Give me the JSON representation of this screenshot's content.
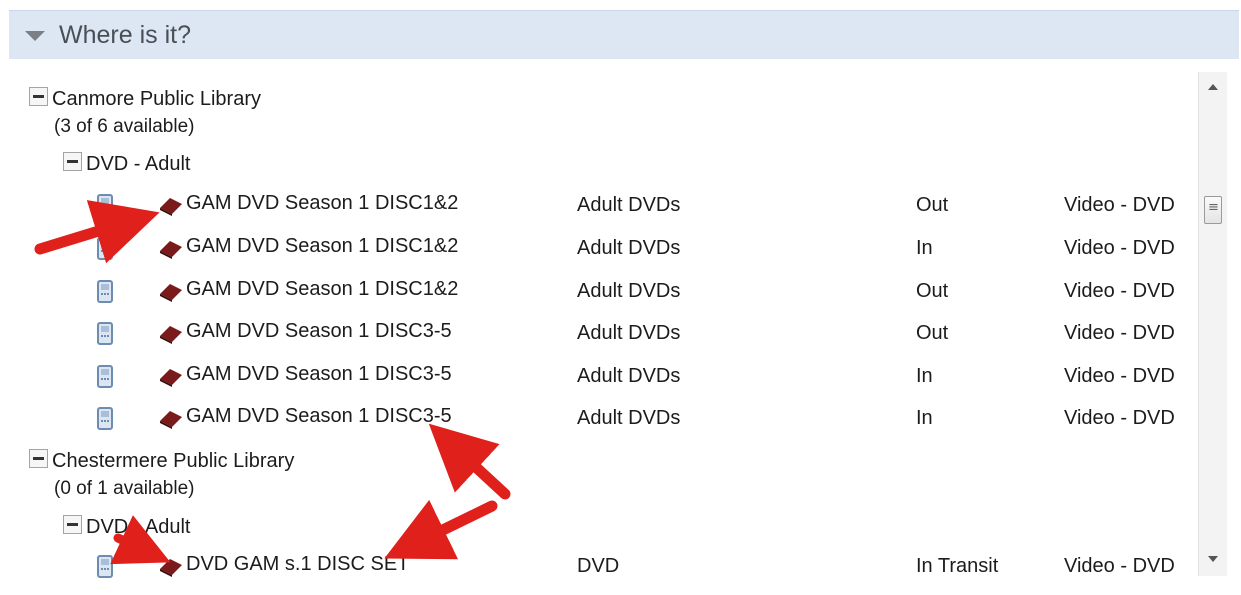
{
  "panel": {
    "title": "Where is it?"
  },
  "libraries": [
    {
      "name": "Canmore Public Library",
      "availability": "(3 of 6 available)",
      "collection": "DVD - Adult",
      "items": [
        {
          "call_number": "GAM DVD Season 1 DISC1&2",
          "collection": "Adult DVDs",
          "status": "Out",
          "format": "Video - DVD"
        },
        {
          "call_number": "GAM DVD Season 1 DISC1&2",
          "collection": "Adult DVDs",
          "status": "In",
          "format": "Video - DVD"
        },
        {
          "call_number": "GAM DVD Season 1 DISC1&2",
          "collection": "Adult DVDs",
          "status": "Out",
          "format": "Video - DVD"
        },
        {
          "call_number": "GAM DVD Season 1 DISC3-5",
          "collection": "Adult DVDs",
          "status": "Out",
          "format": "Video - DVD"
        },
        {
          "call_number": "GAM DVD Season 1 DISC3-5",
          "collection": "Adult DVDs",
          "status": "In",
          "format": "Video - DVD"
        },
        {
          "call_number": "GAM DVD Season 1 DISC3-5",
          "collection": "Adult DVDs",
          "status": "In",
          "format": "Video - DVD"
        }
      ]
    },
    {
      "name": "Chestermere Public Library",
      "availability": "(0 of 1 available)",
      "collection": "DVD - Adult",
      "items": [
        {
          "call_number": "DVD GAM s.1 DISC SET",
          "collection": "DVD",
          "status": "In Transit",
          "format": "Video - DVD"
        }
      ]
    }
  ],
  "icons": {
    "header_toggle": "triangle-down-icon",
    "collapse": "minus-box-icon",
    "item": "phone-icon",
    "material": "book-icon",
    "annotation": "red-arrow-icon"
  },
  "colors": {
    "header_bg": "#dde7f4",
    "arrow": "#e0201b",
    "book": "#7a1a1a"
  }
}
